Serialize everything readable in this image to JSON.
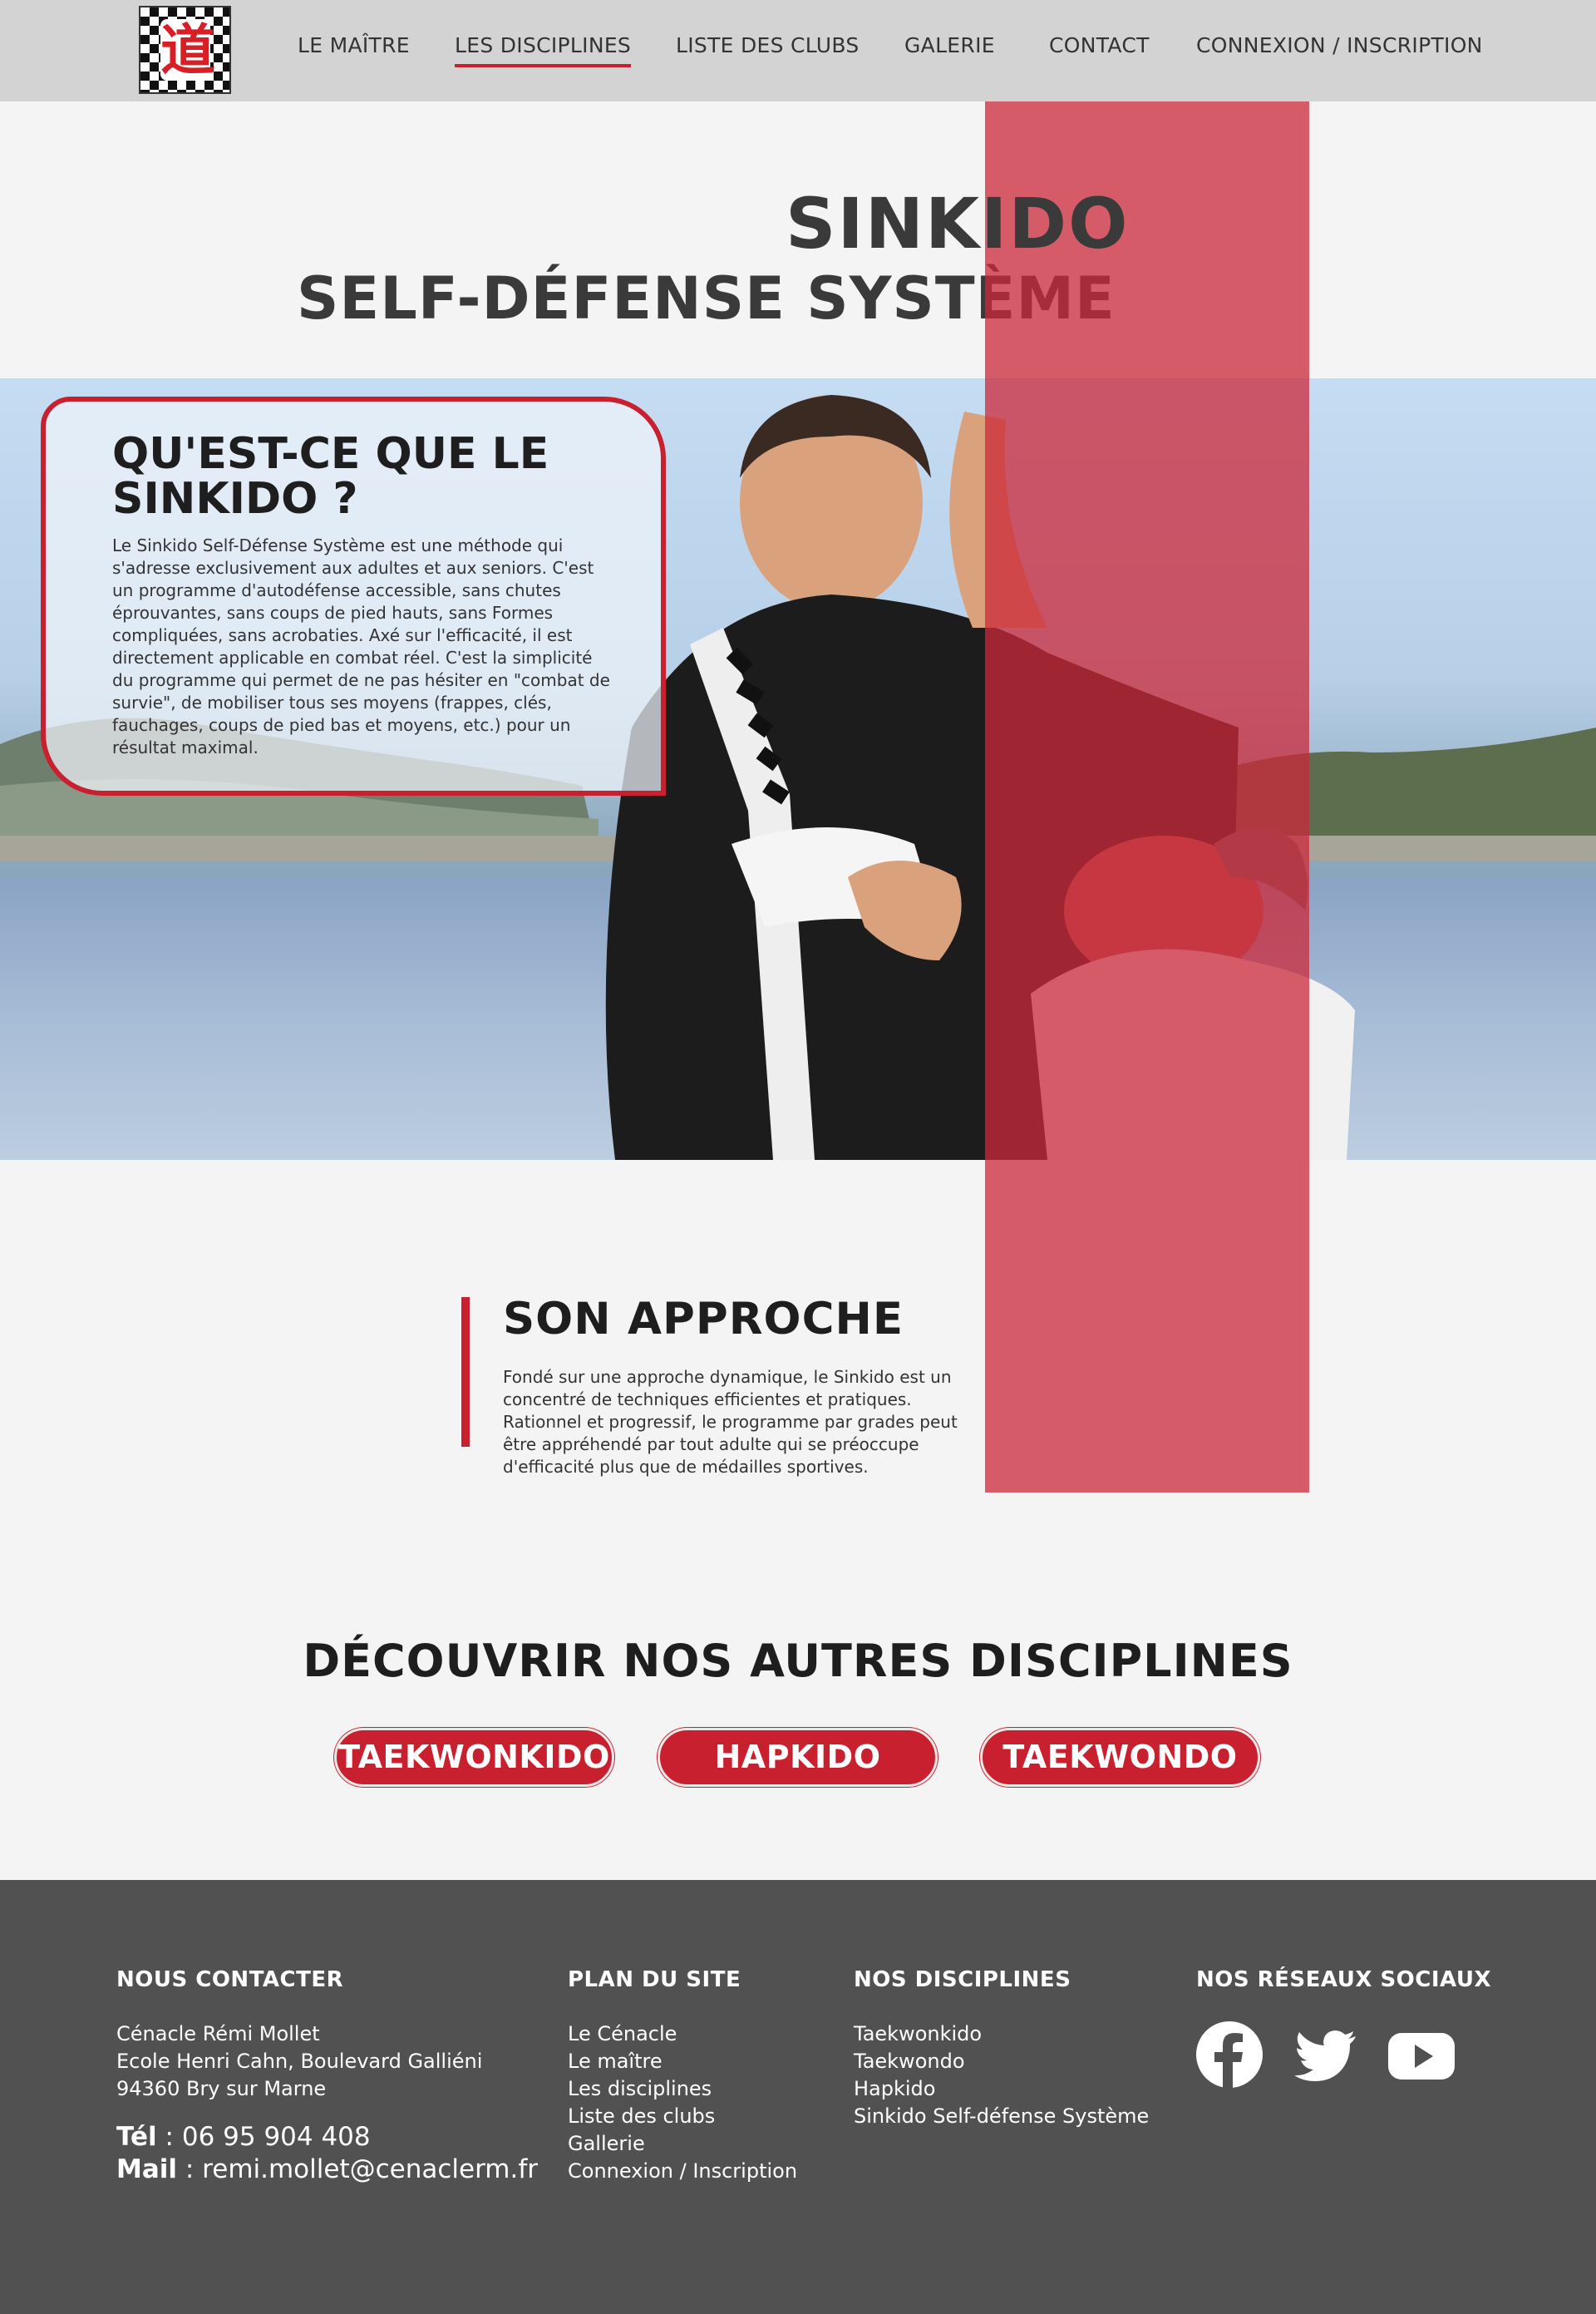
{
  "nav": {
    "items": [
      {
        "label": "LE MAÎTRE"
      },
      {
        "label": "LES DISCIPLINES"
      },
      {
        "label": "LISTE DES CLUBS"
      },
      {
        "label": "GALERIE"
      },
      {
        "label": "CONTACT"
      },
      {
        "label": "CONNEXION / INSCRIPTION"
      }
    ],
    "active_index": 1
  },
  "hero": {
    "title": "SINKIDO",
    "subtitle": "SELF-DÉFENSE SYSTÈME"
  },
  "info": {
    "title": "QU'EST-CE QUE LE SINKIDO ?",
    "text": "Le Sinkido Self-Défense Système est une méthode qui s'adresse exclusivement aux adultes et aux seniors. C'est un programme d'autodéfense accessible, sans chutes éprouvantes, sans coups de pied hauts, sans Formes compliquées, sans acrobaties. Axé sur l'efficacité, il est directement applicable en combat réel. C'est la simplicité du programme qui permet de ne pas hésiter en \"combat de survie\", de mobiliser tous ses moyens (frappes, clés, fauchages, coups de pied bas et moyens, etc.) pour un résultat maximal."
  },
  "approach": {
    "title": "SON APPROCHE",
    "text": "Fondé sur une approche dynamique, le Sinkido est un concentré de techniques efficientes et pratiques. Rationnel et progressif, le programme par grades peut être appréhendé par tout adulte qui se préoccupe d'efficacité plus que de médailles sportives."
  },
  "discover": {
    "title": "DÉCOUVRIR NOS AUTRES DISCIPLINES",
    "buttons": [
      {
        "label": "TAEKWONKIDO"
      },
      {
        "label": "HAPKIDO"
      },
      {
        "label": "TAEKWONDO"
      }
    ]
  },
  "footer": {
    "contact": {
      "heading": "NOUS CONTACTER",
      "lines": [
        "Cénacle Rémi Mollet",
        "Ecole Henri Cahn, Boulevard Galliéni",
        "94360 Bry sur Marne"
      ],
      "tel_label": "Tél",
      "tel": " : 06 95 904 408",
      "mail_label": "Mail",
      "mail": " : remi.mollet@cenaclerm.fr"
    },
    "plan": {
      "heading": "PLAN DU SITE",
      "links": [
        "Le Cénacle",
        "Le maître",
        "Les disciplines",
        "Liste des clubs",
        "Gallerie",
        "Connexion / Inscription"
      ]
    },
    "disciplines": {
      "heading": "NOS DISCIPLINES",
      "links": [
        "Taekwonkido",
        "Taekwondo",
        "Hapkido",
        "Sinkido Self-défense Système"
      ]
    },
    "social": {
      "heading": "NOS RÉSEAUX SOCIAUX",
      "icons": [
        "facebook-icon",
        "twitter-icon",
        "youtube-icon"
      ]
    }
  },
  "colors": {
    "accent": "#c8202f",
    "nav_bg": "#d3d3d3",
    "footer_bg": "#515151",
    "page_bg": "#f4f4f4"
  }
}
